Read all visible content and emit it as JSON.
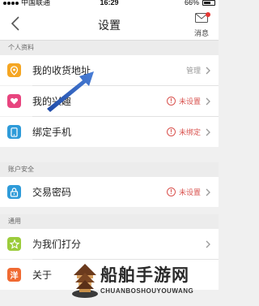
{
  "status_bar": {
    "carrier": "中国联通",
    "time": "16:29",
    "battery": "66%",
    "battery_level": 0.66
  },
  "header": {
    "title": "设置",
    "message_label": "消息"
  },
  "sections": [
    {
      "header": "个人资料",
      "items": [
        {
          "label": "我的收货地址",
          "status": "管理",
          "icon": "location-icon",
          "color": "#f5a623"
        },
        {
          "label": "我的兴趣",
          "status": "未设置",
          "icon": "heart-icon",
          "color": "#e8457f"
        },
        {
          "label": "绑定手机",
          "status": "未绑定",
          "icon": "phone-icon",
          "color": "#2e9bd9"
        }
      ]
    },
    {
      "header": "账户安全",
      "items": [
        {
          "label": "交易密码",
          "status": "未设置",
          "icon": "lock-icon",
          "color": "#2e9bd9"
        }
      ]
    },
    {
      "header": "通用",
      "items": [
        {
          "label": "为我们打分",
          "status": "",
          "icon": "star-icon",
          "color": "#9ccc3c"
        },
        {
          "label": "关于",
          "status": "",
          "icon": "about-icon",
          "color": "#f06a32"
        }
      ]
    }
  ],
  "watermark": {
    "title": "船舶手游网",
    "subtitle": "CHUANBOSHOUYOUWANG"
  },
  "colors": {
    "alert_red": "#d9534f",
    "arrow_blue": "#2c5db8"
  }
}
